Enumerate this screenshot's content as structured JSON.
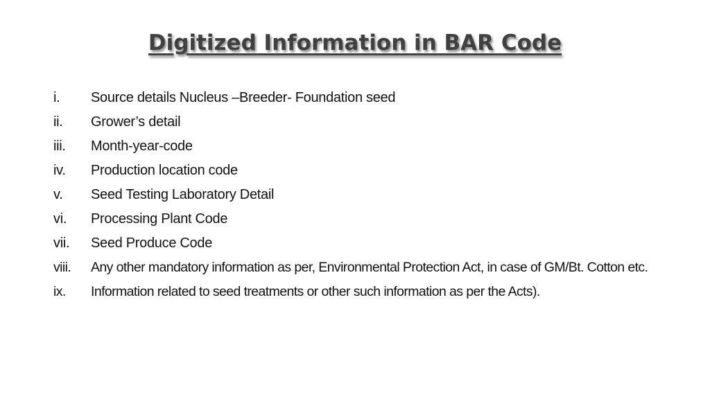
{
  "title": "Digitized Information in BAR Code",
  "items": [
    {
      "num": "i.",
      "text": "Source details Nucleus –Breeder- Foundation seed"
    },
    {
      "num": "ii.",
      "text": "Grower’s detail"
    },
    {
      "num": "iii.",
      "text": "Month-year-code"
    },
    {
      "num": "iv.",
      "text": "Production location code"
    },
    {
      "num": "v.",
      "text": "Seed Testing Laboratory Detail"
    },
    {
      "num": "vi.",
      "text": "Processing Plant Code"
    },
    {
      "num": "vii.",
      "text": "Seed Produce Code"
    },
    {
      "num": "viii.",
      "text": "Any other mandatory information as per, Environmental Protection Act, in case of GM/Bt. Cotton etc."
    },
    {
      "num": "ix.",
      "text": "Information related to seed treatments or other such information as per the Acts)."
    }
  ]
}
